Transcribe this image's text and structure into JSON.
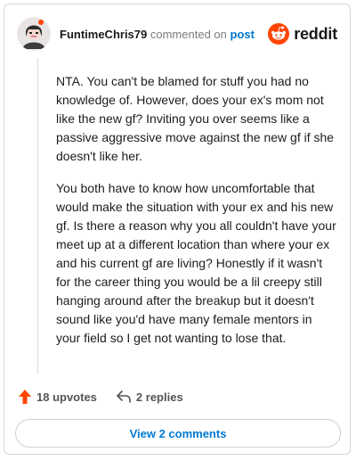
{
  "comment": {
    "author": "FuntimeChris79",
    "commented_on_text": "commented on",
    "post_link_label": "post",
    "paragraphs": [
      "NTA. You can't be blamed for stuff you had no knowledge of. However, does your ex's mom not like the new gf? Inviting you over seems like a passive aggressive move against the new gf if she doesn't like her.",
      "You both have to know how uncomfortable that would make the situation with your ex and his new gf. Is there a reason why you all couldn't have your meet up at a different location than where your ex and his current gf are living? Honestly if it wasn't for the career thing you would be a lil creepy still hanging around after the breakup but it doesn't sound like you'd have many female mentors in your field so I get not wanting to lose that."
    ],
    "upvotes_label": "18 upvotes",
    "replies_label": "2 replies",
    "view_comments_label": "View 2 comments"
  },
  "brand": {
    "wordmark": "reddit",
    "icon": "reddit-snoo-icon",
    "color": "#ff4500"
  },
  "icons": {
    "upvote": "upvote-arrow-icon",
    "reply": "reply-arrow-icon",
    "avatar": "user-avatar"
  },
  "colors": {
    "link": "#0079d3",
    "upvote": "#ff4500",
    "muted": "#7c7c7c"
  }
}
